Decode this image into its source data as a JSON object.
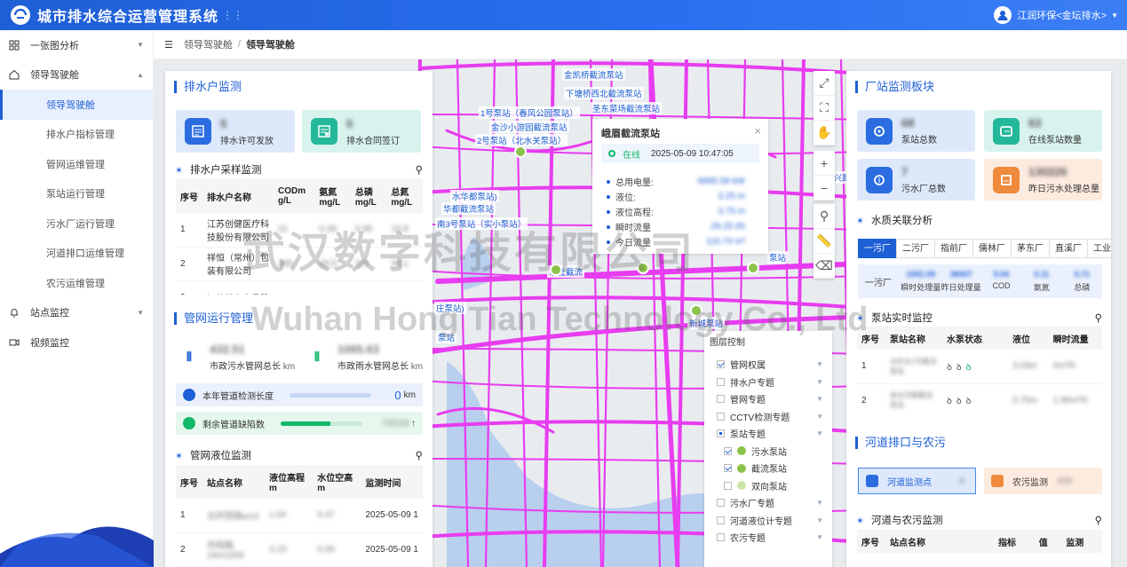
{
  "app": {
    "title": "城市排水综合运营管理系统",
    "user": "江润环保<金坛排水>"
  },
  "sidebar": {
    "items": [
      {
        "label": "一张图分析",
        "icon": "grid-icon"
      },
      {
        "label": "领导驾驶舱",
        "icon": "home-icon"
      },
      {
        "label": "领导驾驶舱",
        "sub": true,
        "active": true
      },
      {
        "label": "排水户指标管理",
        "sub": true
      },
      {
        "label": "管网运维管理",
        "sub": true
      },
      {
        "label": "泵站运行管理",
        "sub": true
      },
      {
        "label": "污水厂运行管理",
        "sub": true
      },
      {
        "label": "河道排口运维管理",
        "sub": true
      },
      {
        "label": "农污运维管理",
        "sub": true
      },
      {
        "label": "站点监控",
        "icon": "bell-icon"
      },
      {
        "label": "视频监控",
        "icon": "video-icon"
      }
    ]
  },
  "breadcrumb": {
    "level1": "领导驾驶舱",
    "sep": "/",
    "level2": "领导驾驶舱"
  },
  "left": {
    "drainage_title": "排水户监测",
    "permit": {
      "value": "5",
      "label": "排水许可发放"
    },
    "contract": {
      "value": "0",
      "label": "排水合同签订"
    },
    "sampling_title": "排水户采样监测",
    "sampling_headers": [
      "序号",
      "排水户名称",
      "CODm g/L",
      "氨氮 mg/L",
      "总磷 mg/L",
      "总氮 mg/L"
    ],
    "sampling_rows": [
      [
        "1",
        "江苏创健医疗科技股份有限公司",
        "21",
        "0.39",
        "0.95",
        "10.8"
      ],
      [
        "2",
        "祥恒（常州）包装有限公司",
        "286",
        "28.5",
        "3.9",
        "36.1"
      ],
      [
        "3",
        "江苏常丰食品股",
        "",
        "",
        "",
        ""
      ]
    ],
    "pipe_title": "管网运行管理",
    "sewage_pipe": {
      "value": "432.51",
      "label": "市政污水管网总长",
      "unit": "km"
    },
    "rain_pipe": {
      "value": "1065.63",
      "label": "市政雨水管网总长",
      "unit": "km"
    },
    "inspect": {
      "label": "本年管道检测长度",
      "value": "0",
      "unit": "km"
    },
    "defect": {
      "label": "剩余管道缺陷数",
      "value": "73/119",
      "progress": 0.61
    },
    "level_title": "管网液位监测",
    "level_headers": [
      "序号",
      "站点名称",
      "液位高程 m",
      "水位空高 m",
      "监测时间"
    ],
    "level_rows": [
      [
        "1",
        "北环西路w14",
        "1.64",
        "0.47",
        "2025-05-09 1"
      ],
      [
        "2",
        "丹阳路 24m1059",
        "3.23",
        "0.09",
        "2025-05-09 1"
      ]
    ]
  },
  "popup": {
    "title": "峨眉截流泵站",
    "status": "在线",
    "time": "2025-05-09 10:47:05",
    "rows": [
      {
        "k": "总用电量:",
        "v": "6895.58 kW"
      },
      {
        "k": "液位:",
        "v": "3.25 m"
      },
      {
        "k": "液位高程:",
        "v": "3.75 m"
      },
      {
        "k": "瞬时流量",
        "v": "29.25 t/h"
      },
      {
        "k": "今日流量",
        "v": "116.74 m³"
      }
    ]
  },
  "map_labels": [
    "金凯桥截流泵站",
    "下塘桥西北截流泵站",
    "圣东菜场截流泵站",
    "1号泵站（春风公园泵站）",
    "金沙小游园截流泵站",
    "2号泵站（北水关泵站）",
    "水华都泵站)",
    "华都截流泵站",
    "南3号泵站（实小泵站）",
    "东社截流",
    "庄泵站)",
    "泵站",
    "新城泵站",
    "泵站",
    "中兴路"
  ],
  "layers": {
    "title": "图层控制",
    "items": [
      {
        "label": "管网权属",
        "state": "on",
        "level": 0
      },
      {
        "label": "排水户专题",
        "state": "off",
        "level": 0
      },
      {
        "label": "管网专题",
        "state": "off",
        "level": 0
      },
      {
        "label": "CCTV检测专题",
        "state": "off",
        "level": 0
      },
      {
        "label": "泵站专题",
        "state": "part",
        "level": 0
      },
      {
        "label": "污水泵站",
        "state": "on",
        "level": 1
      },
      {
        "label": "截流泵站",
        "state": "on",
        "level": 1
      },
      {
        "label": "双向泵站",
        "state": "off",
        "level": 1
      },
      {
        "label": "污水厂专题",
        "state": "off",
        "level": 0
      },
      {
        "label": "河道液位计专题",
        "state": "off",
        "level": 0
      },
      {
        "label": "农污专题",
        "state": "off",
        "level": 0
      }
    ]
  },
  "right": {
    "station_title": "厂站监测板块",
    "pump_total": {
      "value": "68",
      "label": "泵站总数"
    },
    "pump_online": {
      "value": "63",
      "label": "在线泵站数量"
    },
    "plant_total": {
      "value": "7",
      "label": "污水厂总数"
    },
    "yesterday": {
      "value": "130226",
      "label": "昨日污水处理总量"
    },
    "quality_title": "水质关联分析",
    "tabs": [
      "一污厂",
      "二污厂",
      "指前厂",
      "儒林厂",
      "茅东厂",
      "直溪厂",
      "工业厂"
    ],
    "quality_plant": "一污厂",
    "quality_labels": [
      "瞬时处理量",
      "昨日处理量",
      "COD",
      "氨氮",
      "总磷"
    ],
    "quality_values": [
      "1052.09",
      "38407",
      "9.04",
      "0.11",
      "0.71"
    ],
    "pump_rt_title": "泵站实时监控",
    "pump_headers": [
      "序号",
      "泵站名称",
      "水泵状态",
      "液位",
      "瞬时流量"
    ],
    "pump_rows": [
      [
        "1",
        "水杉东1号截流泵站",
        "3.03m",
        "0m³/h"
      ],
      [
        "2",
        "金水华都截流泵站",
        "0.70m",
        "1.96m³/h"
      ]
    ],
    "river_title": "河道排口与农污",
    "river_btn": {
      "label": "河道监测点",
      "value": "6"
    },
    "rural_btn": {
      "label": "农污监测",
      "value": "103"
    },
    "river_table_title": "河道与农污监测",
    "river_headers": [
      "序号",
      "站点名称",
      "指标",
      "值",
      "监测"
    ]
  },
  "watermark": {
    "cn": "武汉数字科技有限公司",
    "en": "Wuhan Hong Tian Technology Co., Ltd"
  },
  "colors": {
    "brand": "#1f5fd6",
    "pipe": "#e83cf0",
    "online": "#13b86a"
  }
}
